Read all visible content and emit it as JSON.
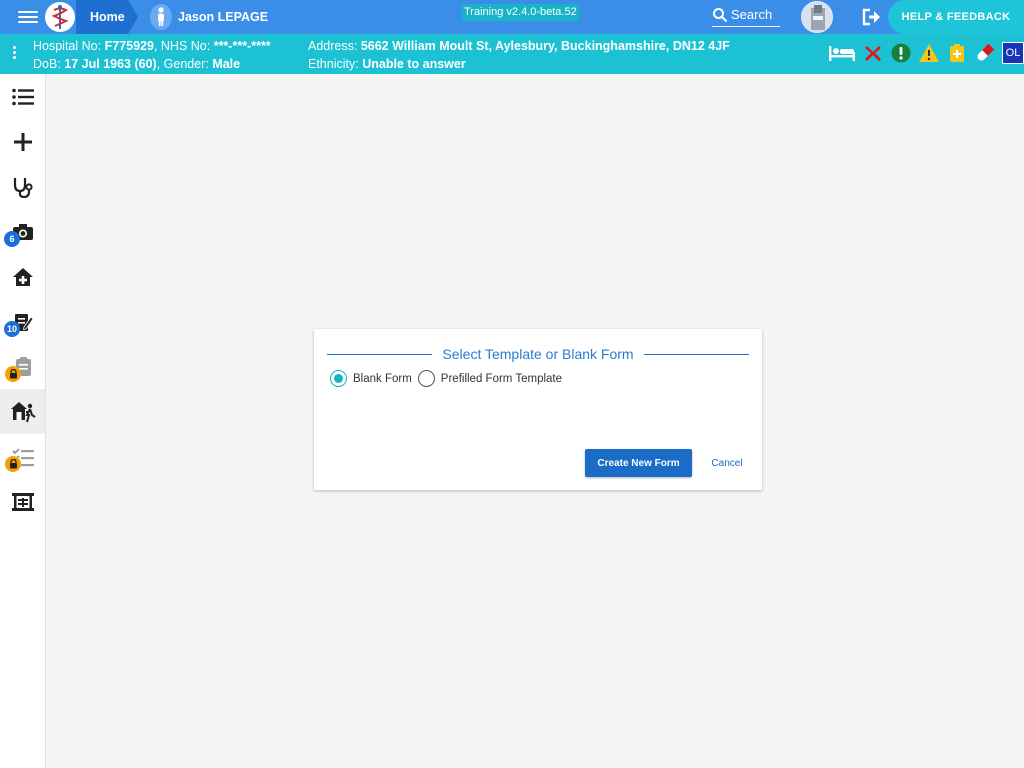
{
  "topbar": {
    "home_label": "Home",
    "patient_name": "Jason LEPAGE",
    "version": "Training v2.4.0-beta.52",
    "search_label": "Search",
    "help_label": "HELP & FEEDBACK"
  },
  "banner": {
    "hospital_no_label": "Hospital No:",
    "hospital_no": "F775929",
    "nhs_no_label": "NHS No:",
    "nhs_no": "***-***-****",
    "dob_label": "DoB:",
    "dob": "17 Jul 1963 (60)",
    "gender_label": "Gender:",
    "gender": "Male",
    "address_label": "Address:",
    "address": "5662 William Moult St, Aylesbury, Buckinghamshire, DN12 4JF",
    "ethnicity_label": "Ethnicity:",
    "ethnicity": "Unable to answer",
    "ol_badge": "OL"
  },
  "sidebar": {
    "items": [
      {
        "icon": "list-icon"
      },
      {
        "icon": "plus-icon"
      },
      {
        "icon": "stethoscope-icon"
      },
      {
        "icon": "camera-icon",
        "badge": "6"
      },
      {
        "icon": "home-plus-icon"
      },
      {
        "icon": "edit-document-icon",
        "badge": "10"
      },
      {
        "icon": "clipboard-icon",
        "locked": true
      },
      {
        "icon": "house-walking-icon",
        "active": true
      },
      {
        "icon": "checklist-icon",
        "locked": true
      },
      {
        "icon": "theatre-icon"
      }
    ]
  },
  "dialog": {
    "title": "Select Template or Blank Form",
    "radio_blank": "Blank Form",
    "radio_prefilled": "Prefilled Form Template",
    "selected": "Blank Form",
    "create_label": "Create New Form",
    "cancel_label": "Cancel"
  },
  "colors": {
    "topbar": "#3b8ee8",
    "banner": "#1cc2d3",
    "primary": "#1b6cc6",
    "badge_blue": "#1b6fd6",
    "lock_orange": "#f5a100"
  }
}
